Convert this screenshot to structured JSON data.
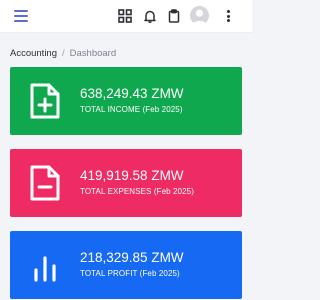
{
  "header": {
    "icons": [
      "menu-icon",
      "apps-grid-icon",
      "bell-icon",
      "clipboard-icon",
      "user-avatar",
      "more-vertical-icon"
    ],
    "accent_color": "#5b6dd9"
  },
  "breadcrumb": {
    "root": "Accounting",
    "separator": "/",
    "current": "Dashboard"
  },
  "cards": {
    "income": {
      "value": "638,249.43 ZMW",
      "label": "TOTAL INCOME (Feb 2025)",
      "color": "#0fa84e",
      "icon": "file-plus-icon"
    },
    "expenses": {
      "value": "419,919.58 ZMW",
      "label": "TOTAL EXPENSES (Feb 2025)",
      "color": "#ee2b63",
      "icon": "file-minus-icon"
    },
    "profit": {
      "value": "218,329.85 ZMW",
      "label": "TOTAL PROFIT (Feb 2025)",
      "color": "#1669f2",
      "icon": "bar-chart-icon"
    }
  }
}
